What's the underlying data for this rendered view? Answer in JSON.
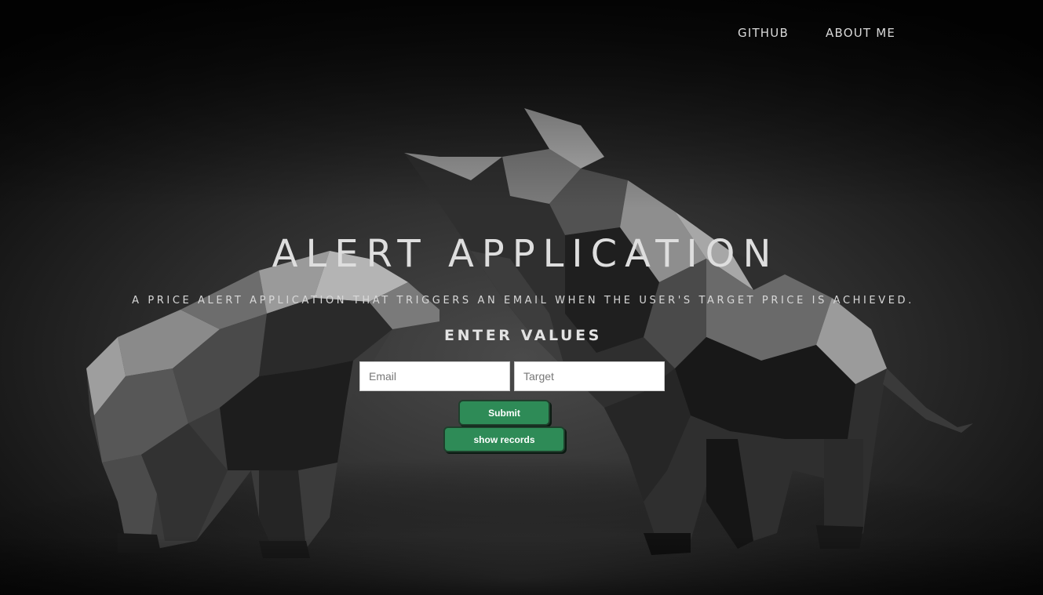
{
  "nav": {
    "github_label": "GITHUB",
    "about_label": "ABOUT ME"
  },
  "hero": {
    "title": "ALERT APPLICATION",
    "subtitle": "A PRICE ALERT APPLICATION THAT TRIGGERS AN EMAIL WHEN THE USER'S TARGET PRICE IS ACHIEVED."
  },
  "form": {
    "heading": "ENTER VALUES",
    "email_placeholder": "Email",
    "email_value": "",
    "target_placeholder": "Target",
    "target_value": "",
    "submit_label": "Submit",
    "show_records_label": "show records"
  },
  "background": {
    "description_icon": "low-poly-bull-and-bear-illustration"
  },
  "colors": {
    "button_green": "#2e8b57",
    "text_light": "#dedede",
    "background_dark": "#000000"
  }
}
